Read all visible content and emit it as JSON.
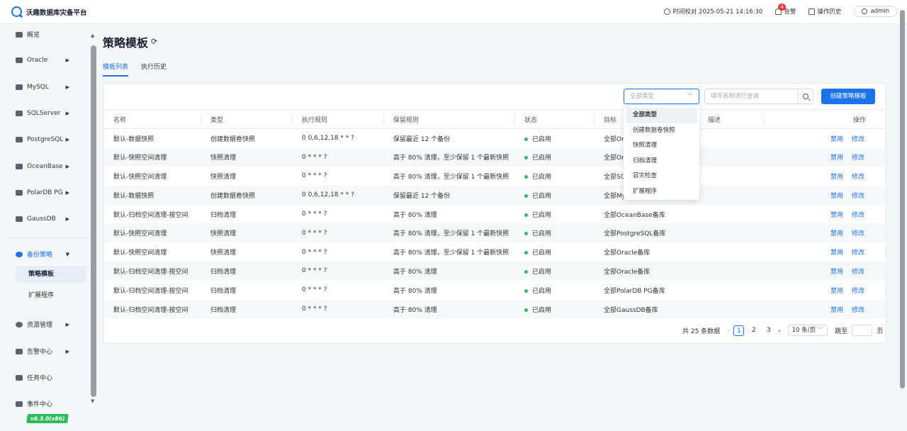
{
  "header": {
    "app_name": "沃趣数据库灾备平台",
    "time_label": "时间校对 2025-05-21 14:16:30",
    "alert_label": "告警",
    "alert_count": "4",
    "history_label": "操作历史",
    "user_name": "admin"
  },
  "sidebar": {
    "items": [
      {
        "label": "概览",
        "icon": "bar-chart-icon"
      },
      {
        "label": "Oracle",
        "icon": "database-icon"
      },
      {
        "label": "MySQL",
        "icon": "database-icon"
      },
      {
        "label": "SQLServer",
        "icon": "database-icon"
      },
      {
        "label": "PostgreSQL",
        "icon": "database-icon"
      },
      {
        "label": "OceanBase",
        "icon": "database-icon"
      },
      {
        "label": "PolarDB PG",
        "icon": "database-icon"
      },
      {
        "label": "GaussDB",
        "icon": "database-icon"
      },
      {
        "label": "备份策略",
        "icon": "policy-icon"
      },
      {
        "label": "资源管理",
        "icon": "resource-icon"
      },
      {
        "label": "告警中心",
        "icon": "alert-icon"
      },
      {
        "label": "任务中心",
        "icon": "task-icon"
      },
      {
        "label": "事件中心",
        "icon": "event-icon"
      }
    ],
    "subitems": [
      "策略模板",
      "扩展程序"
    ],
    "version": "v6.3.0(x86)"
  },
  "page": {
    "title": "策略模板",
    "tabs": [
      "模板列表",
      "执行历史"
    ]
  },
  "toolbar": {
    "type_placeholder": "全部类型",
    "search_placeholder": "填写名称进行查询",
    "create_label": "创建策略模板"
  },
  "dropdown": {
    "options": [
      "全部类型",
      "创建数据卷快照",
      "快照清理",
      "归档清理",
      "容灾检查",
      "扩展程序"
    ]
  },
  "table": {
    "columns": [
      "名称",
      "类型",
      "执行规则",
      "保留规则",
      "状态",
      "目标",
      "描述",
      "操作"
    ],
    "rows": [
      {
        "name": "默认-数据快照",
        "type": "创建数据卷快照",
        "schedule": "0 0,6,12,18 * * ?",
        "retention": "保留最近 12 个备份",
        "status": "已启用",
        "target": "全部Oracle备库",
        "desc": "",
        "op1": "禁用",
        "op2": "修改"
      },
      {
        "name": "默认-快照空间清理",
        "type": "快照清理",
        "schedule": "0 * * * ?",
        "retention": "高于 80% 清理，至少保留 1 个最新快照",
        "status": "已启用",
        "target": "全部Oracle备库",
        "desc": "",
        "op1": "禁用",
        "op2": "修改"
      },
      {
        "name": "默认-快照空间清理",
        "type": "快照清理",
        "schedule": "0 * * * ?",
        "retention": "高于 80% 清理，至少保留 1 个最新快照",
        "status": "已启用",
        "target": "全部SQLServer备库",
        "desc": "",
        "op1": "禁用",
        "op2": "修改"
      },
      {
        "name": "默认-数据快照",
        "type": "创建数据卷快照",
        "schedule": "0 0,6,12,18 * * ?",
        "retention": "保留最近 12 个备份",
        "status": "已启用",
        "target": "全部MySQL备库",
        "desc": "",
        "op1": "禁用",
        "op2": "修改"
      },
      {
        "name": "默认-归档空间清理-按空间",
        "type": "归档清理",
        "schedule": "0 * * * ?",
        "retention": "高于 80% 清理",
        "status": "已启用",
        "target": "全部OceanBase备库",
        "desc": "",
        "op1": "禁用",
        "op2": "修改"
      },
      {
        "name": "默认-快照空间清理",
        "type": "快照清理",
        "schedule": "0 * * * ?",
        "retention": "高于 80% 清理，至少保留 1 个最新快照",
        "status": "已启用",
        "target": "全部PostgreSQL备库",
        "desc": "",
        "op1": "禁用",
        "op2": "修改"
      },
      {
        "name": "默认-快照空间清理",
        "type": "快照清理",
        "schedule": "0 * * * ?",
        "retention": "高于 80% 清理，至少保留 1 个最新快照",
        "status": "已启用",
        "target": "全部Oracle备库",
        "desc": "",
        "op1": "禁用",
        "op2": "修改"
      },
      {
        "name": "默认-归档空间清理-按空间",
        "type": "归档清理",
        "schedule": "0 * * * ?",
        "retention": "高于 80% 清理",
        "status": "已启用",
        "target": "全部Oracle备库",
        "desc": "",
        "op1": "禁用",
        "op2": "修改"
      },
      {
        "name": "默认-归档空间清理-按空间",
        "type": "归档清理",
        "schedule": "0 * * * ?",
        "retention": "高于 80% 清理",
        "status": "已启用",
        "target": "全部PolarDB PG备库",
        "desc": "",
        "op1": "禁用",
        "op2": "修改"
      },
      {
        "name": "默认-归档空间清理-按空间",
        "type": "归档清理",
        "schedule": "0 * * * ?",
        "retention": "高于 80% 清理",
        "status": "已启用",
        "target": "全部GaussDB备库",
        "desc": "",
        "op1": "禁用",
        "op2": "修改"
      }
    ]
  },
  "pagination": {
    "total_label": "共 25 条数据",
    "pages": [
      "1",
      "2",
      "3"
    ],
    "current": "1",
    "size_label": "10 条/页",
    "jump_label": "跳至",
    "page_suffix": "页"
  },
  "colors": {
    "accent": "#1a73e8",
    "status_enabled": "#2cbb5b",
    "badge": "#e53935"
  }
}
